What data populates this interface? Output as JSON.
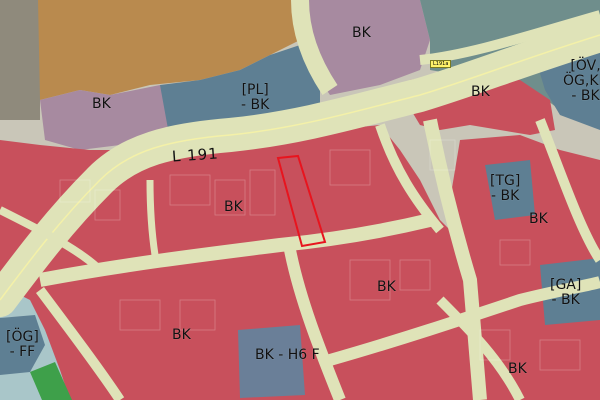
{
  "road_main": "L 191",
  "road_shield": "L191a",
  "zones": [
    {
      "id": "bk-north",
      "text": "BK"
    },
    {
      "id": "bk-northwest",
      "text": "BK"
    },
    {
      "id": "pl-bk",
      "text": "[PL]\n- BK"
    },
    {
      "id": "ov-og-ki-bk",
      "text": "[ÖV,\nÖG,KI]\n- BK"
    },
    {
      "id": "bk-northeast-block",
      "text": "BK"
    },
    {
      "id": "bk-central",
      "text": "BK"
    },
    {
      "id": "tg-bk",
      "text": "[TG]\n- BK"
    },
    {
      "id": "bk-east",
      "text": "BK"
    },
    {
      "id": "bk-south-center",
      "text": "BK"
    },
    {
      "id": "ga-bk",
      "text": "[GA]\n- BK"
    },
    {
      "id": "og-ff",
      "text": "[ÖG]\n- FF"
    },
    {
      "id": "bk-southwest",
      "text": "BK"
    },
    {
      "id": "bk-h6f",
      "text": "BK - H6 F"
    },
    {
      "id": "bk-southeast",
      "text": "BK"
    }
  ],
  "colors": {
    "residential": "#c8505c",
    "residential_light": "#d86a72",
    "orange": "#b98a4e",
    "purple": "#a78aa0",
    "blue": "#5e7f93",
    "road": "#dfe3b8",
    "road_edge": "#f4f1a8",
    "green": "#3ea04a",
    "water": "#a9c6c9",
    "highlight": "#e8141e"
  }
}
